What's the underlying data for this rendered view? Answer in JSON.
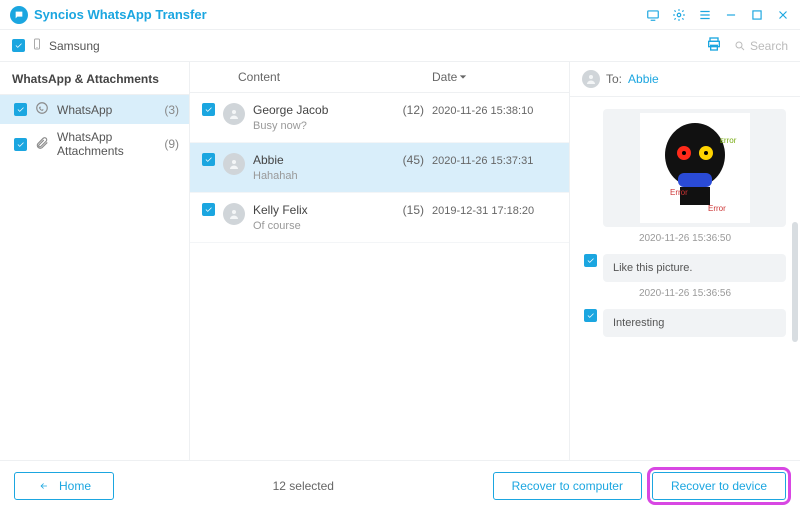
{
  "app": {
    "title": "Syncios WhatsApp Transfer"
  },
  "toolbar": {
    "device_name": "Samsung",
    "search_placeholder": "Search"
  },
  "sidebar": {
    "header": "WhatsApp & Attachments",
    "items": [
      {
        "label": "WhatsApp",
        "count": "(3)",
        "active": true,
        "icon": "whatsapp"
      },
      {
        "label": "WhatsApp Attachments",
        "count": "(9)",
        "active": false,
        "icon": "attachment"
      }
    ]
  },
  "list": {
    "col_content": "Content",
    "col_date": "Date",
    "rows": [
      {
        "name": "George Jacob",
        "count": "(12)",
        "snippet": "Busy now?",
        "date": "2020-11-26 15:38:10",
        "selected": false
      },
      {
        "name": "Abbie",
        "count": "(45)",
        "snippet": "Hahahah",
        "date": "2020-11-26 15:37:31",
        "selected": true
      },
      {
        "name": "Kelly Felix",
        "count": "(15)",
        "snippet": "Of course",
        "date": "2019-12-31 17:18:20",
        "selected": false
      }
    ]
  },
  "chat": {
    "to_label": "To:",
    "to_name": "Abbie",
    "sticker_errors": {
      "a": "ᴇrror",
      "b": "Error",
      "c": "Error"
    },
    "messages": [
      {
        "type": "image",
        "time": "2020-11-26 15:36:50"
      },
      {
        "type": "text",
        "text": "Like this picture.",
        "time": "2020-11-26 15:36:56"
      },
      {
        "type": "text",
        "text": "Interesting",
        "time": ""
      }
    ]
  },
  "footer": {
    "home": "Home",
    "selected_text": "12 selected",
    "recover_computer": "Recover to computer",
    "recover_device": "Recover to device"
  }
}
